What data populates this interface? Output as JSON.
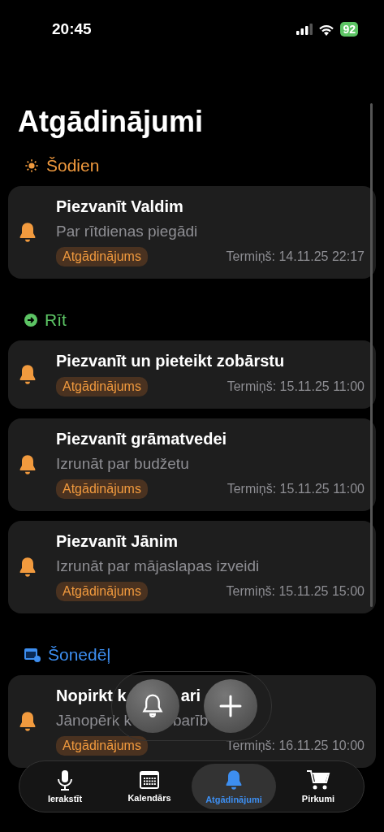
{
  "status_bar": {
    "time": "20:45",
    "battery": "92"
  },
  "title": "Atgādinājumi",
  "sections": [
    {
      "kind": "today",
      "label": "Šodien",
      "color": "#f19a3e",
      "cards": [
        {
          "title": "Piezvanīt Valdim",
          "subtitle": "Par rītdienas piegādi",
          "tag": "Atgādinājums",
          "deadline": "Termiņš: 14.11.25 22:17"
        }
      ]
    },
    {
      "kind": "tomorrow",
      "label": "Rīt",
      "color": "#5cc464",
      "cards": [
        {
          "title": "Piezvanīt un pieteikt zobārstu",
          "tag": "Atgādinājums",
          "deadline": "Termiņš: 15.11.25 11:00"
        },
        {
          "title": "Piezvanīt grāmatvedei",
          "subtitle": "Izrunāt par budžetu",
          "tag": "Atgādinājums",
          "deadline": "Termiņš: 15.11.25 11:00"
        },
        {
          "title": "Piezvanīt Jānim",
          "subtitle": "Izrunāt par mājaslapas izveidi",
          "tag": "Atgādinājums",
          "deadline": "Termiņš: 15.11.25 15:00"
        }
      ]
    },
    {
      "kind": "week",
      "label": "Šonedēļ",
      "color": "#3d8ef0",
      "cards": [
        {
          "title": "Nopirkt k",
          "title_tail": "ari",
          "subtitle": "Jānopērk k",
          "subtitle_tail": "barīb",
          "tag": "Atgādinājums",
          "deadline": "Termiņš: 16.11.25 10:00"
        }
      ]
    }
  ],
  "tabs": [
    {
      "kind": "mic",
      "label": "Ierakstīt",
      "selected": false
    },
    {
      "kind": "calendar",
      "label": "Kalendārs",
      "selected": false
    },
    {
      "kind": "bell",
      "label": "Atgādinājumi",
      "selected": true
    },
    {
      "kind": "cart",
      "label": "Pirkumi",
      "selected": false
    }
  ]
}
